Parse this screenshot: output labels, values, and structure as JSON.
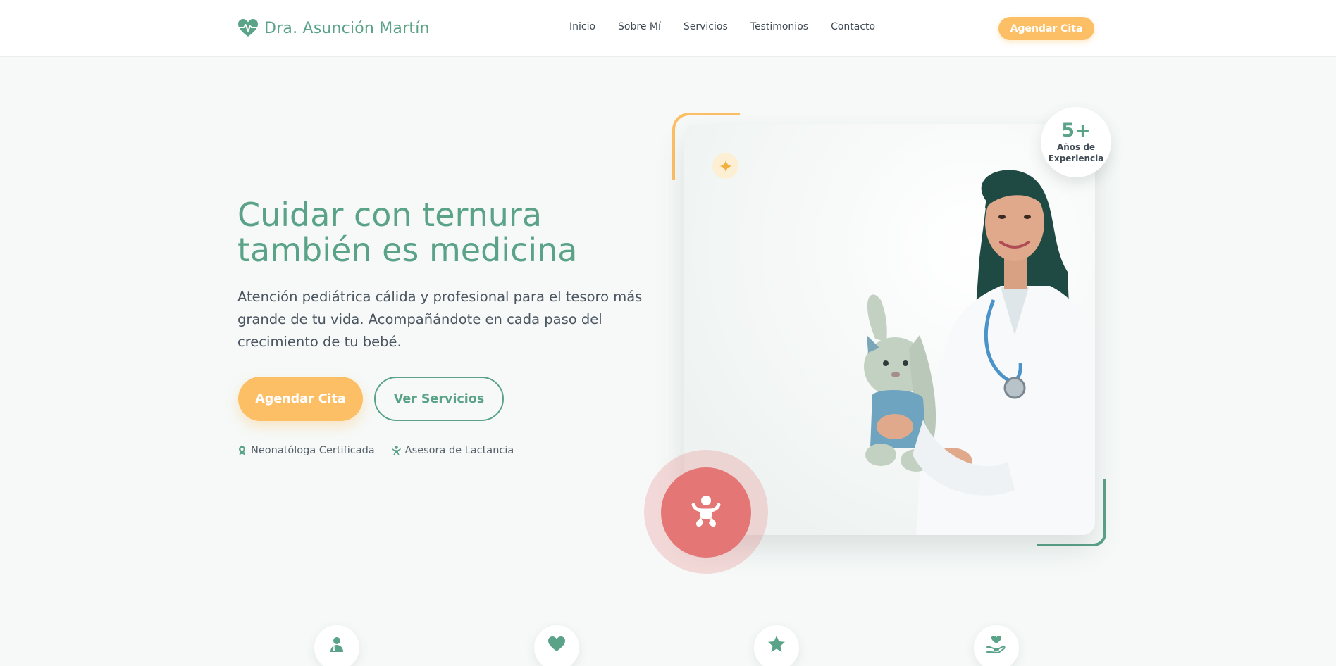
{
  "header": {
    "brand": "Dra. Asunción Martín",
    "nav": [
      "Inicio",
      "Sobre Mí",
      "Servicios",
      "Testimonios",
      "Contacto"
    ],
    "cta": "Agendar Cita"
  },
  "hero": {
    "title": "Cuidar con ternura también es medicina",
    "description": "Atención pediátrica cálida y profesional para el tesoro más grande de tu vida. Acompañándote en cada paso del crecimiento de tu bebé.",
    "primary_button": "Agendar Cita",
    "secondary_button": "Ver Servicios",
    "badges": [
      {
        "icon": "award-icon",
        "label": "Neonatóloga Certificada"
      },
      {
        "icon": "baby-icon",
        "label": "Asesora de Lactancia"
      }
    ]
  },
  "experience": {
    "number": "5+",
    "label": "Años de Experiencia"
  },
  "features": [
    {
      "icon": "doctor-icon"
    },
    {
      "icon": "heart-icon"
    },
    {
      "icon": "star-icon"
    },
    {
      "icon": "hand-heart-icon"
    }
  ],
  "colors": {
    "primary_green": "#5aa288",
    "accent_orange": "#fdbf65",
    "coral": "#e47676",
    "background": "#f6f9f8"
  }
}
